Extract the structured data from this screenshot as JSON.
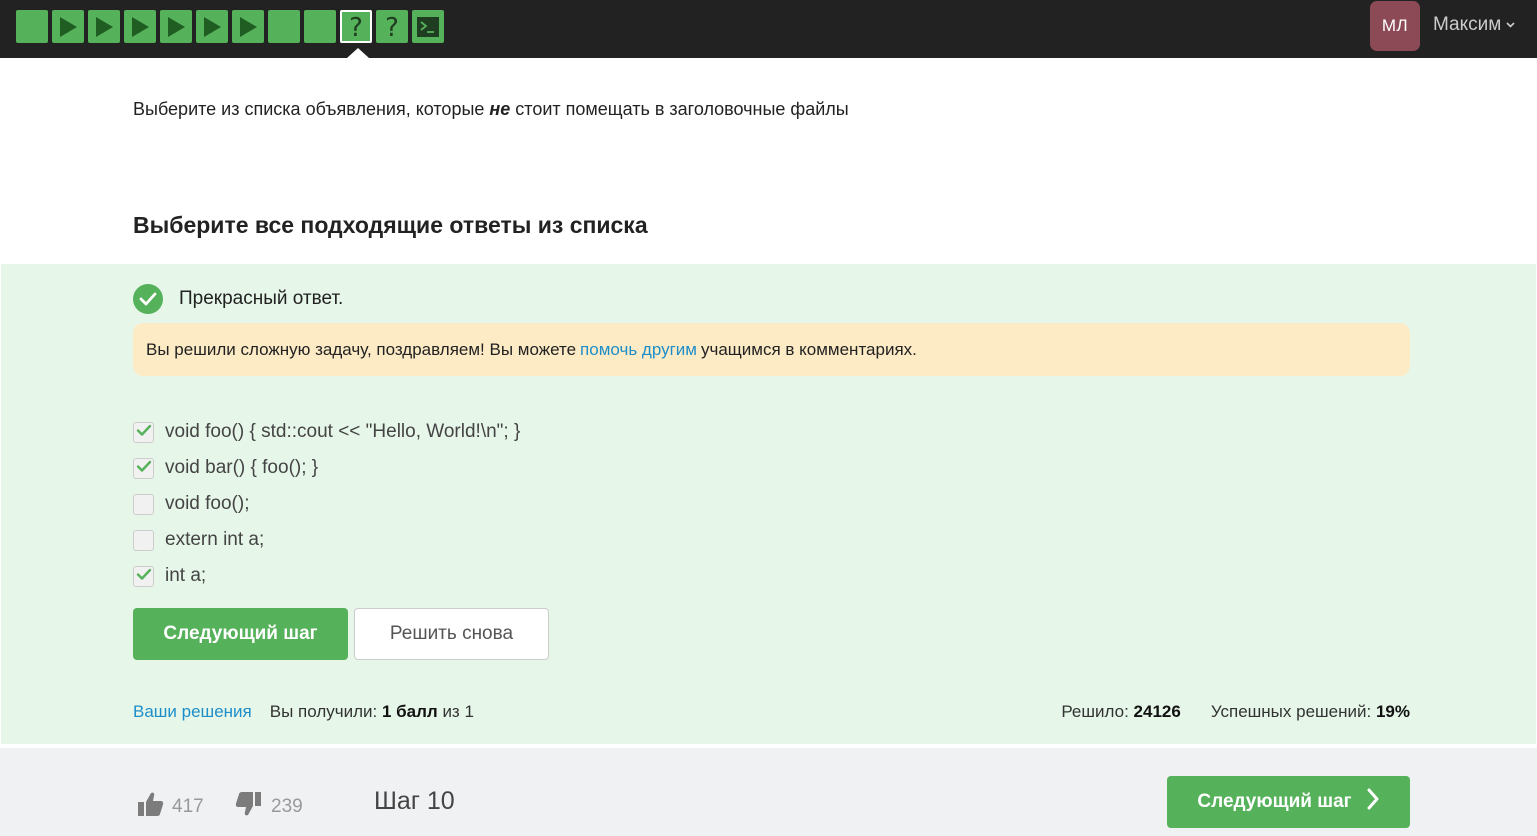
{
  "topbar": {
    "steps": [
      {
        "kind": "text",
        "icon": "text-step-icon",
        "active": false
      },
      {
        "kind": "video",
        "icon": "play-icon",
        "active": false
      },
      {
        "kind": "video",
        "icon": "play-icon",
        "active": false
      },
      {
        "kind": "video",
        "icon": "play-icon",
        "active": false
      },
      {
        "kind": "video",
        "icon": "play-icon",
        "active": false
      },
      {
        "kind": "video",
        "icon": "play-icon",
        "active": false
      },
      {
        "kind": "video",
        "icon": "play-icon",
        "active": false
      },
      {
        "kind": "text",
        "icon": "text-step-icon",
        "active": false
      },
      {
        "kind": "text",
        "icon": "text-step-icon",
        "active": false
      },
      {
        "kind": "quiz",
        "icon": "question-icon",
        "active": true
      },
      {
        "kind": "quiz",
        "icon": "question-icon",
        "active": false
      },
      {
        "kind": "code",
        "icon": "terminal-icon",
        "active": false
      }
    ],
    "avatar_initials": "МЛ",
    "user_name": "Максим",
    "colors": {
      "bar": "#222222",
      "step": "#55b15a",
      "avatar": "#8b4a55"
    }
  },
  "question": {
    "before": "Выберите из списка объявления, которые ",
    "emphasis": "не",
    "after": " стоит помещать в заголовочные файлы"
  },
  "instruction": "Выберите все подходящие ответы из списка",
  "feedback": {
    "status": "Прекрасный ответ.",
    "hint_before": "Вы решили сложную задачу, поздравляем! Вы можете",
    "hint_link": "помочь другим",
    "hint_after": "учащимся в комментариях."
  },
  "options": [
    {
      "label": "void foo() { std::cout << \"Hello, World!\\n\"; }",
      "checked": true
    },
    {
      "label": "void bar() { foo(); }",
      "checked": true
    },
    {
      "label": "void foo();",
      "checked": false
    },
    {
      "label": "extern int a;",
      "checked": false
    },
    {
      "label": "int a;",
      "checked": true
    }
  ],
  "buttons": {
    "next": "Следующий шаг",
    "retry": "Решить снова"
  },
  "stats": {
    "solutions_link": "Ваши решения",
    "score_prefix": "Вы получили:",
    "score_value": "1 балл",
    "score_suffix": "из 1",
    "solved_label": "Решило:",
    "solved_value": "24126",
    "success_label": "Успешных решений:",
    "success_value": "19%"
  },
  "footer": {
    "likes": "417",
    "dislikes": "239",
    "step_label": "Шаг 10",
    "next_button": "Следующий шаг"
  },
  "colors": {
    "accent_green": "#55b15a",
    "result_bg": "#e6f6e9",
    "hint_bg": "#fdebc6",
    "link": "#1e8ec9"
  }
}
